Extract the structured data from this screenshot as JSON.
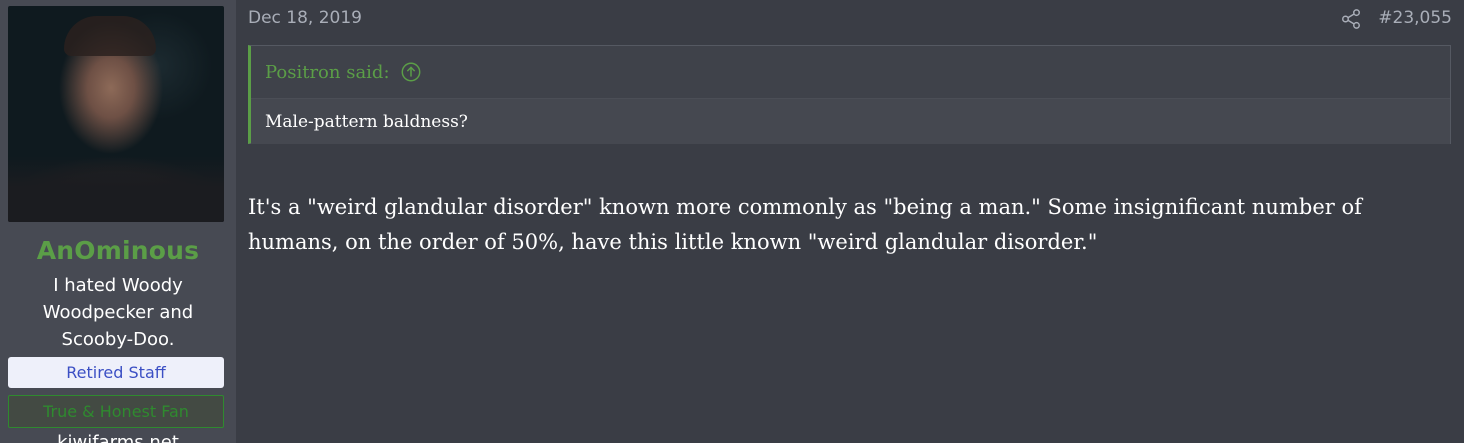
{
  "user": {
    "username": "AnOminous",
    "title": "I hated Woody Woodpecker and Scooby-Doo.",
    "banner_staff": "Retired Staff",
    "banner_fan": "True & Honest Fan",
    "extra": "kiwifarms.net"
  },
  "post": {
    "date": "Dec 18, 2019",
    "number": "#23,055",
    "quote": {
      "author_line": "Positron said:",
      "text": "Male-pattern baldness?"
    },
    "body": "It's a \"weird glandular disorder\" known more commonly as \"being a man.\" Some insignificant number of humans, on the order of 50%, have this little known \"weird glandular disorder.\""
  },
  "colors": {
    "background": "#3a3d45",
    "user_panel": "#474a53",
    "username": "#5b9e47",
    "quote_border": "#5b9e47",
    "staff_banner_bg": "#eef0fa",
    "staff_banner_text": "#3b4fc4",
    "fan_banner_text": "#2f8a2f",
    "meta_text": "#a9aeb8"
  },
  "icons": {
    "share": "share-icon",
    "quote_jump": "arrow-up-circle-icon"
  }
}
